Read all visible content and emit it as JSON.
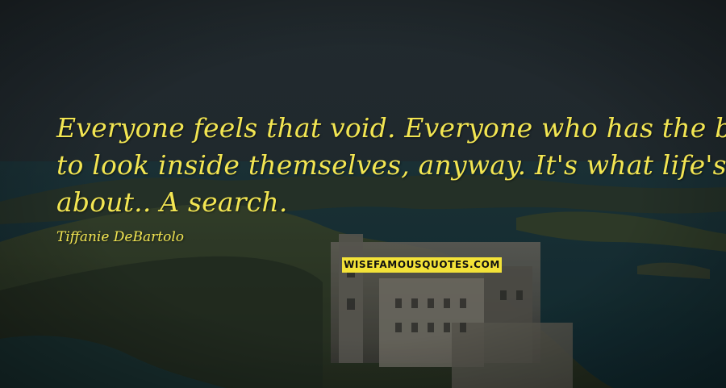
{
  "quote": {
    "lines": [
      "Everyone feels that void. Everyone who has the balls",
      "to look inside themselves, anyway. It's what life's all",
      "about.. A search."
    ]
  },
  "author": "Tiffanie DeBartolo",
  "watermark": "WISEFAMOUSQUOTES.COM",
  "colors": {
    "text": "#f2e552",
    "watermark_bg": "#f3e238"
  }
}
